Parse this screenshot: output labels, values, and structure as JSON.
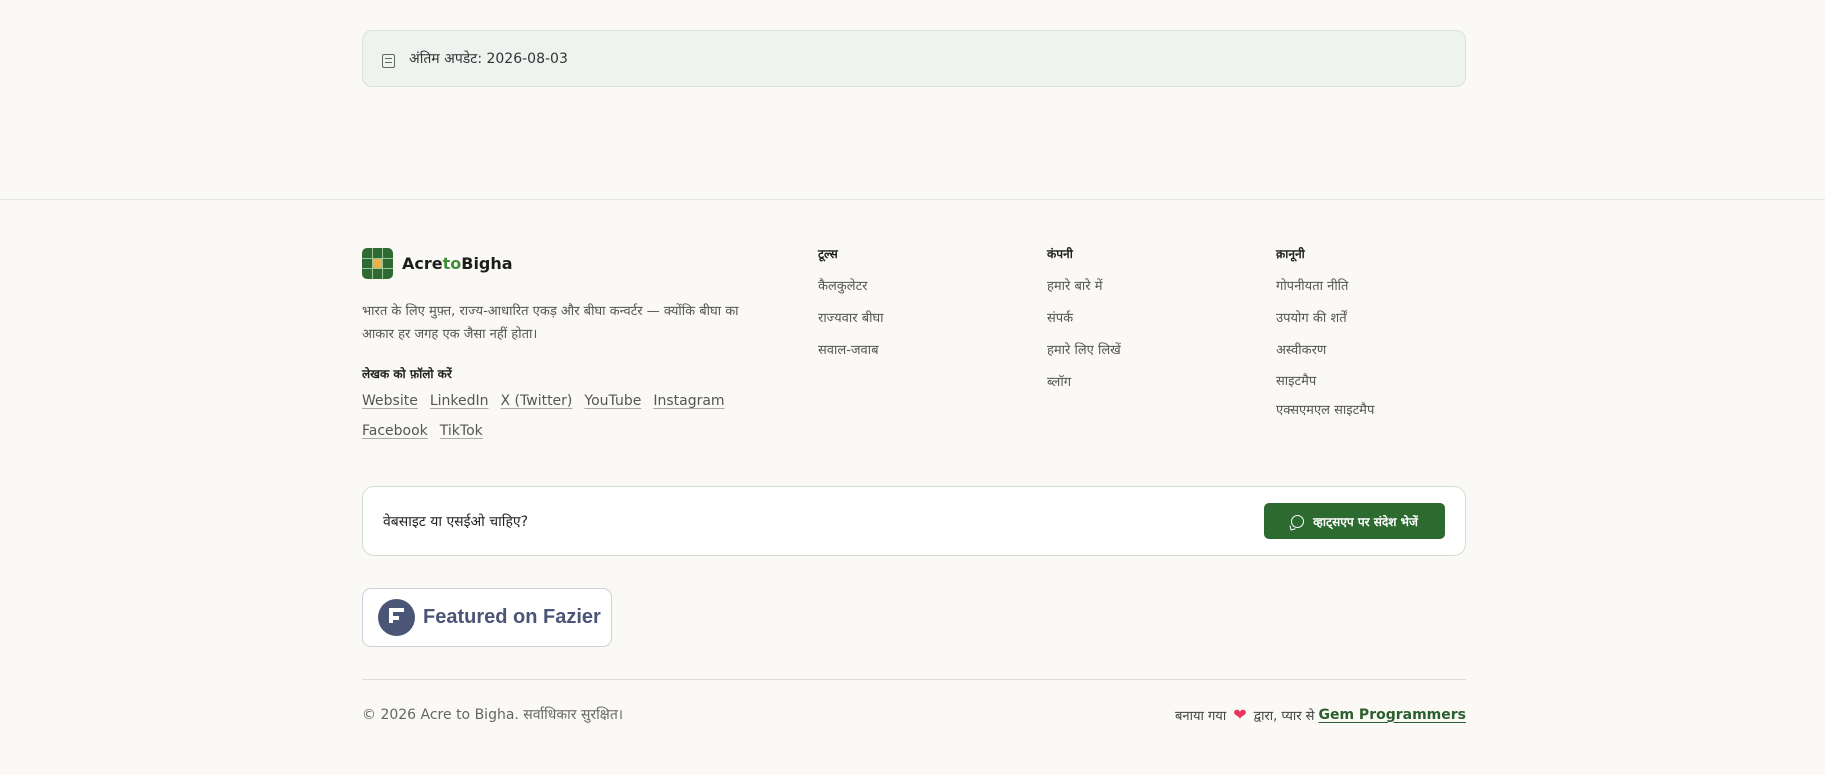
{
  "update": {
    "icon": "document-icon",
    "text": "अंतिम अपडेट: 2026-08-03"
  },
  "brand": {
    "name_part1": "Acre",
    "name_part2": "to",
    "name_part3": "Bigha",
    "logo": "acre-to-bigha-logo",
    "accent": "#2f6a33"
  },
  "tagline": "भारत के लिए मुफ़्त, राज्य-आधारित एकड़ और बीघा कन्वर्टर — क्योंकि बीघा का आकार हर जगह एक जैसा नहीं होता।",
  "follow": {
    "title": "लेखक को फ़ॉलो करें",
    "links": [
      "Website",
      "LinkedIn",
      "X (Twitter)",
      "YouTube",
      "Instagram",
      "Facebook",
      "TikTok"
    ]
  },
  "columns": [
    {
      "title": "टूल्स",
      "links": [
        "कैलकुलेटर",
        "राज्यवार बीघा",
        "सवाल-जवाब"
      ]
    },
    {
      "title": "कंपनी",
      "links": [
        "हमारे बारे में",
        "संपर्क",
        "हमारे लिए लिखें",
        "ब्लॉग"
      ]
    },
    {
      "title": "क़ानूनी",
      "links": [
        "गोपनीयता नीति",
        "उपयोग की शर्तें",
        "अस्वीकरण",
        "साइटमैप",
        "एक्सएमएल साइटमैप"
      ]
    }
  ],
  "cta": {
    "text": "वेबसाइट या एसईओ चाहिए?",
    "button_label": "व्हाट्सएप पर संदेश भेजें",
    "button_icon": "whatsapp-icon"
  },
  "badge": {
    "label": "Featured on Fazier",
    "icon": "fazier-icon"
  },
  "footer": {
    "copyright": "© 2026 Acre to Bigha. सर्वाधिकार सुरक्षित।",
    "made_prefix": "बनाया गया",
    "heart": "❤",
    "made_middle": "द्वारा, प्यार से",
    "credit_link": "Gem Programmers"
  }
}
